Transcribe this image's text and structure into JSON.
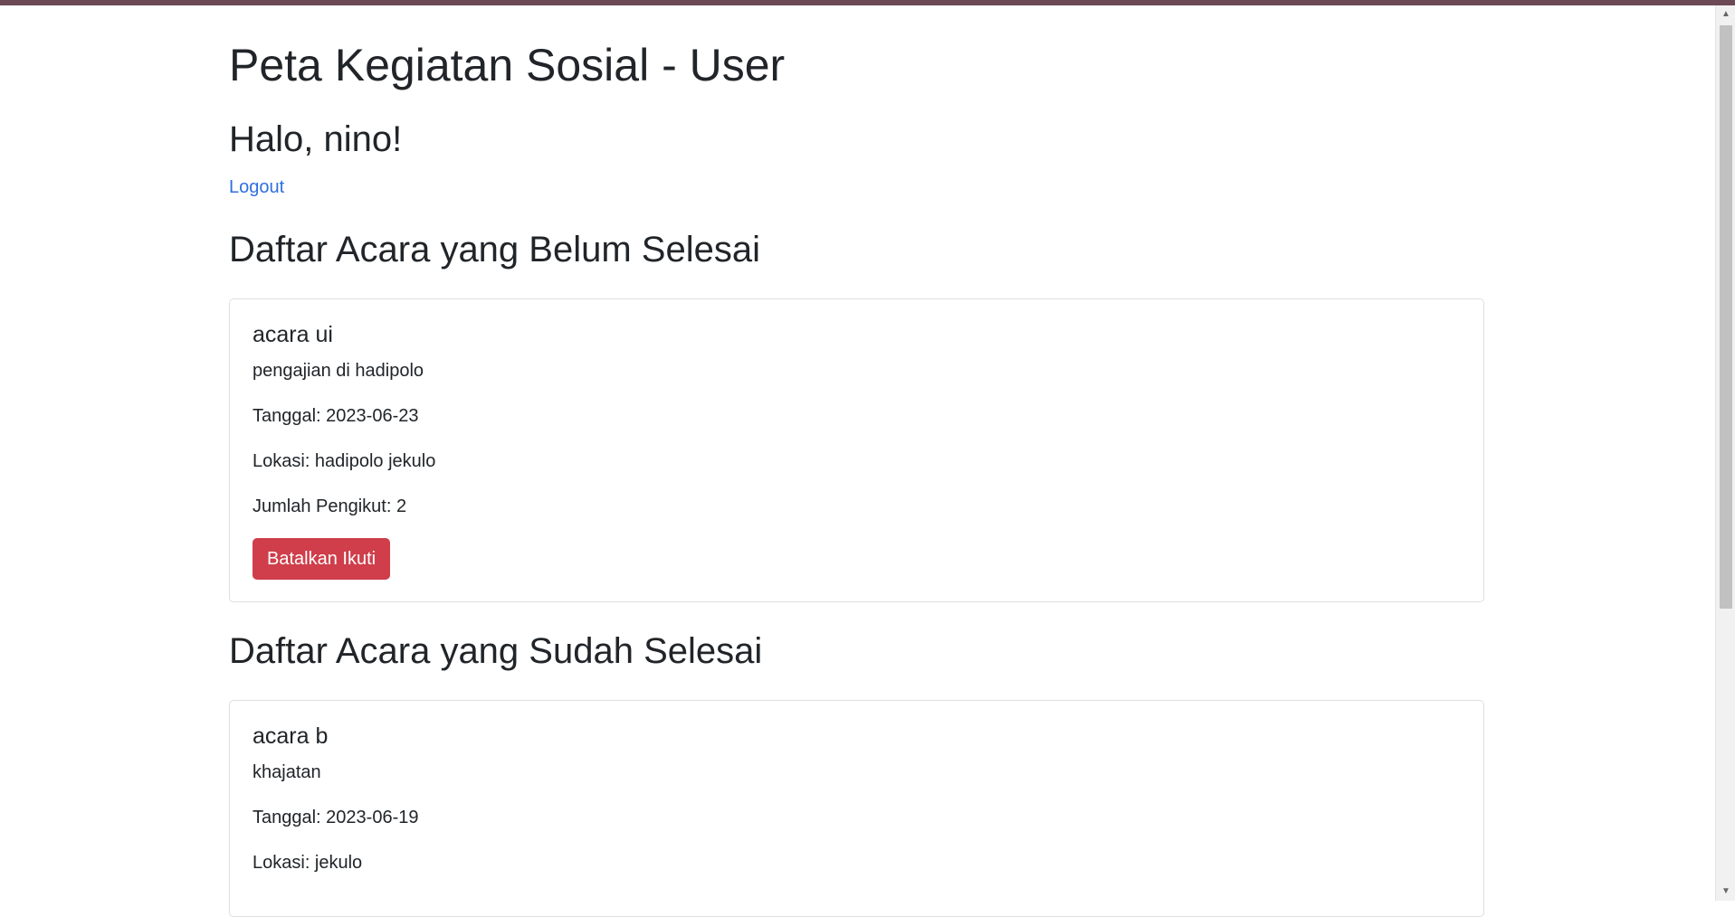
{
  "page": {
    "title": "Peta Kegiatan Sosial - User",
    "greeting": "Halo, nino!",
    "logout_label": "Logout"
  },
  "colors": {
    "top_bar": "#6b4a55",
    "link": "#2f6fe0",
    "danger_button": "#cf3e4a"
  },
  "upcoming": {
    "heading": "Daftar Acara yang Belum Selesai",
    "events": [
      {
        "name": "acara ui",
        "description": "pengajian di hadipolo",
        "date": "Tanggal: 2023-06-23",
        "location": "Lokasi: hadipolo jekulo",
        "followers": "Jumlah Pengikut: 2",
        "button_label": "Batalkan Ikuti"
      }
    ]
  },
  "finished": {
    "heading": "Daftar Acara yang Sudah Selesai",
    "events": [
      {
        "name": "acara b",
        "description": "khajatan",
        "date": "Tanggal: 2023-06-19",
        "location": "Lokasi: jekulo"
      }
    ]
  }
}
